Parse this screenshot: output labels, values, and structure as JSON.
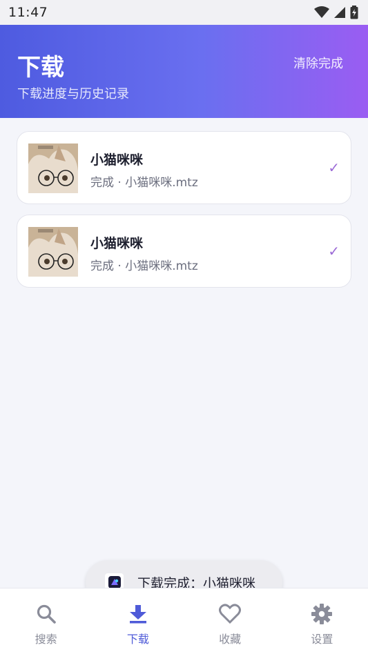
{
  "status_bar": {
    "time": "11:47"
  },
  "header": {
    "title": "下载",
    "subtitle": "下载进度与历史记录",
    "clear_label": "清除完成"
  },
  "downloads": [
    {
      "title": "小猫咪咪",
      "meta": "完成 · 小猫咪咪.mtz",
      "status_icon": "check-icon"
    },
    {
      "title": "小猫咪咪",
      "meta": "完成 · 小猫咪咪.mtz",
      "status_icon": "check-icon"
    }
  ],
  "toast": {
    "text": "下载完成：小猫咪咪"
  },
  "nav": {
    "items": [
      {
        "label": "搜索",
        "icon": "search-icon",
        "active": false
      },
      {
        "label": "下载",
        "icon": "download-icon",
        "active": true
      },
      {
        "label": "收藏",
        "icon": "heart-icon",
        "active": false
      },
      {
        "label": "设置",
        "icon": "gear-icon",
        "active": false
      }
    ]
  },
  "colors": {
    "header_gradient_start": "#4e5be0",
    "header_gradient_end": "#9a5df2",
    "accent": "#4f5bd8",
    "check": "#9b6ad6"
  }
}
